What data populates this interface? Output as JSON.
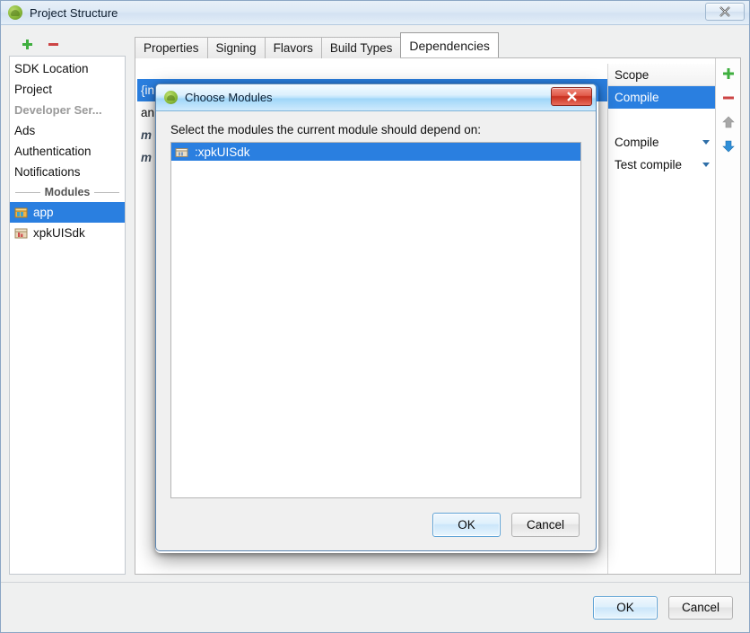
{
  "window": {
    "title": "Project Structure",
    "close_label": "Close",
    "close_icon": "close-icon"
  },
  "left_toolbar": {
    "add_icon": "plus-icon",
    "remove_icon": "minus-icon"
  },
  "sidebar": {
    "items": [
      {
        "label": "SDK Location",
        "type": "plain",
        "selected": false
      },
      {
        "label": "Project",
        "type": "plain",
        "selected": false
      },
      {
        "label": "Developer Ser...",
        "type": "muted",
        "selected": false
      },
      {
        "label": "Ads",
        "type": "plain",
        "selected": false
      },
      {
        "label": "Authentication",
        "type": "plain",
        "selected": false
      },
      {
        "label": "Notifications",
        "type": "plain",
        "selected": false
      }
    ],
    "group_label": "Modules",
    "modules": [
      {
        "label": "app",
        "icon": "module-app-icon",
        "selected": true
      },
      {
        "label": "xpkUISdk",
        "icon": "module-library-icon",
        "selected": false
      }
    ]
  },
  "tabs": [
    {
      "label": "Properties",
      "active": false
    },
    {
      "label": "Signing",
      "active": false
    },
    {
      "label": "Flavors",
      "active": false
    },
    {
      "label": "Build Types",
      "active": false
    },
    {
      "label": "Dependencies",
      "active": true
    }
  ],
  "dependencies": {
    "rows": [
      {
        "label": "{in",
        "style": "plain",
        "selected": true
      },
      {
        "label": "an",
        "style": "plain",
        "selected": false
      },
      {
        "label": "m",
        "style": "italic",
        "selected": false
      },
      {
        "label": "m",
        "style": "italic",
        "selected": false
      }
    ],
    "scope_header": "Scope",
    "scopes": [
      {
        "label": "Compile",
        "selected": true,
        "caret": false
      },
      {
        "label": "",
        "selected": false,
        "caret": false
      },
      {
        "label": "Compile",
        "selected": false,
        "caret": true
      },
      {
        "label": "Test compile",
        "selected": false,
        "caret": true
      }
    ]
  },
  "panel_toolbar": {
    "add_icon": "plus-icon",
    "remove_icon": "minus-icon",
    "move_up_icon": "arrow-up-icon",
    "move_down_icon": "arrow-down-icon"
  },
  "footer": {
    "ok_label": "OK",
    "cancel_label": "Cancel"
  },
  "dialog": {
    "title": "Choose Modules",
    "close_icon": "close-icon",
    "prompt": "Select the modules the current module should depend on:",
    "list": [
      {
        "label": ":xpkUISdk",
        "icon": "module-icon",
        "selected": true
      }
    ],
    "ok_label": "OK",
    "cancel_label": "Cancel"
  },
  "colors": {
    "selection_blue": "#2a7fe0",
    "accent_green": "#3faf3f",
    "accent_red": "#cc4444",
    "arrow_blue": "#2f8fd8",
    "arrow_gray": "#9a9a9a",
    "close_red": "#c8301f"
  }
}
